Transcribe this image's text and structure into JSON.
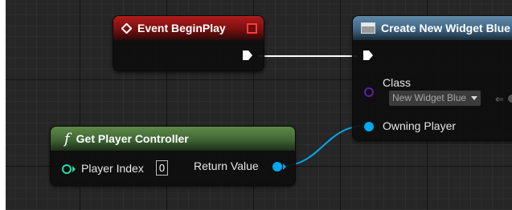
{
  "nodes": {
    "event_begin_play": {
      "title": "Event BeginPlay"
    },
    "create_widget": {
      "title": "Create New Widget Blue",
      "class_label": "Class",
      "class_value": "New Widget Blue",
      "owning_player_label": "Owning Player"
    },
    "get_player_controller": {
      "title": "Get Player Controller",
      "player_index_label": "Player Index",
      "player_index_value": "0",
      "return_value_label": "Return Value"
    }
  },
  "colors": {
    "canvas_bg": "#262626",
    "exec_wire": "#ffffff",
    "object_wire": "#00a8f0",
    "class_pin": "#5a1fa8",
    "int_pin": "#1fe0a8",
    "event_header": "#8e1616",
    "pure_header": "#4c7a3c",
    "function_header": "#4d7896"
  },
  "icons": {
    "event": "event-diamond-icon",
    "function": "function-f-icon",
    "widget": "widget-blueprint-icon",
    "delegate": "delegate-square-icon"
  }
}
